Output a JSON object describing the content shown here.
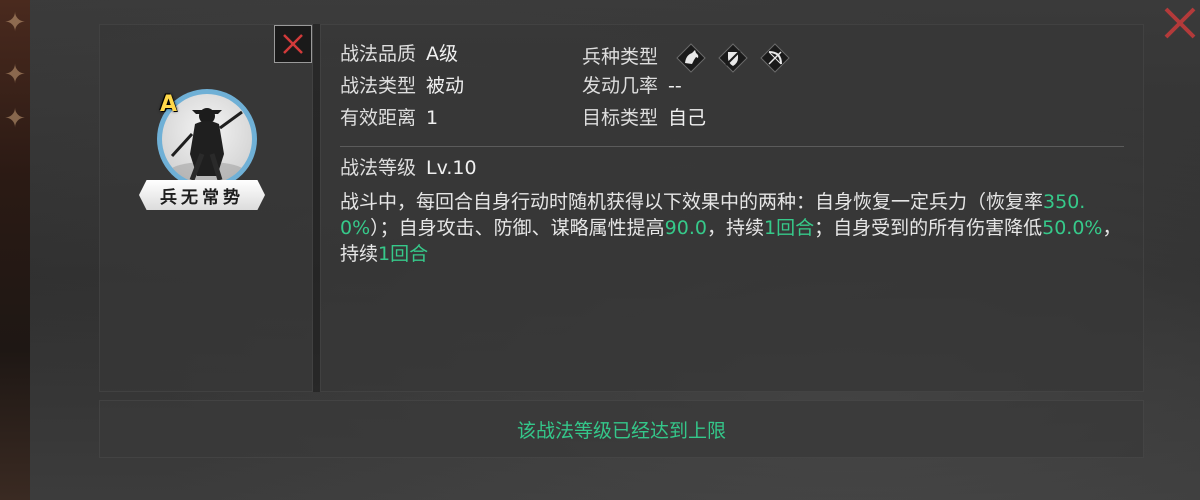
{
  "skill": {
    "grade_letter": "A",
    "name": "兵无常势"
  },
  "info": {
    "quality_label": "战法品质",
    "quality_value": "A级",
    "type_label": "战法类型",
    "type_value": "被动",
    "range_label": "有效距离",
    "range_value": "1",
    "troop_label": "兵种类型",
    "troop_icons": [
      "cavalry-icon",
      "shield-icon",
      "bow-icon"
    ],
    "rate_label": "发动几率",
    "rate_value": "--",
    "target_label": "目标类型",
    "target_value": "自己",
    "level_label": "战法等级",
    "level_value": "Lv.10"
  },
  "description": {
    "p1": "战斗中，每回合自身行动时随机获得以下效果中的两种：自身恢复一定兵力（恢复率",
    "v1": "350.0%",
    "p2": "）；自身攻击、防御、谋略属性提高",
    "v2": "90.0",
    "p3": "，持续",
    "v3": "1回合",
    "p4": "；自身受到的所有伤害降低",
    "v4": "50.0%",
    "p5": "，持续",
    "v5": "1回合"
  },
  "footer": {
    "message": "该战法等级已经达到上限"
  },
  "colors": {
    "highlight": "#36c98a",
    "grade": "#ffd84a",
    "ring": "#6fb0d6",
    "close_red": "#d23a3a"
  }
}
